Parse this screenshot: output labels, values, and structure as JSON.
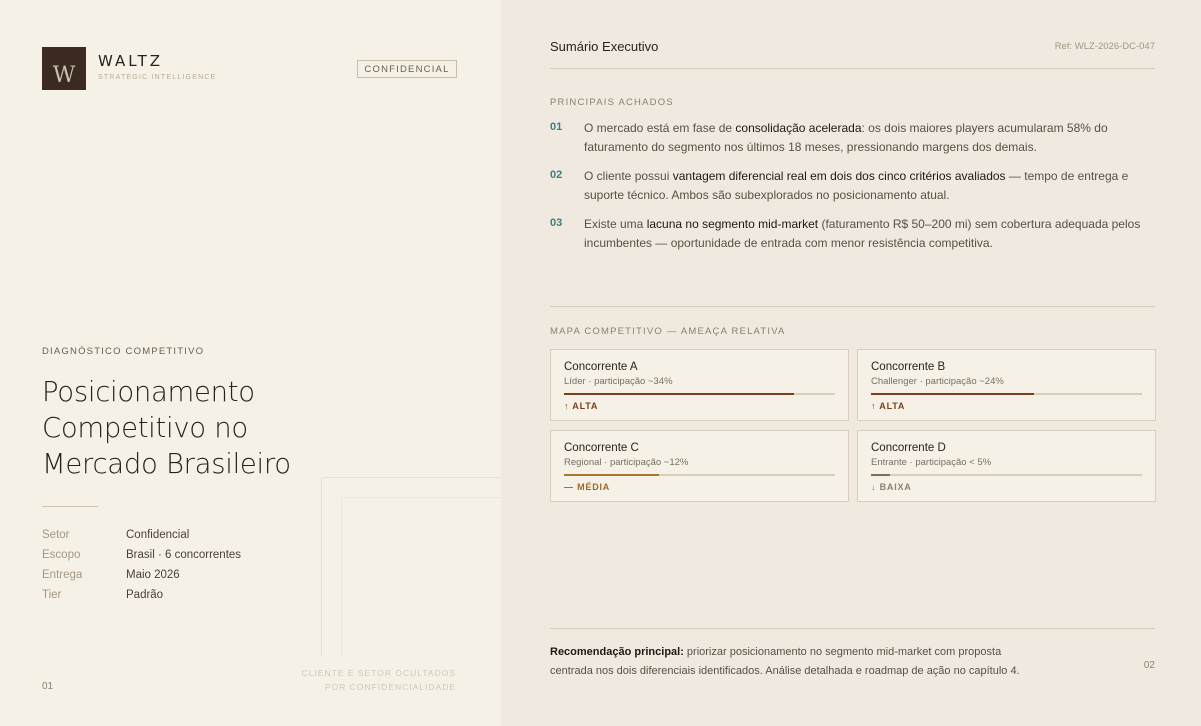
{
  "left": {
    "logo": {
      "name": "WALTZ",
      "tagline": "STRATEGIC INTELLIGENCE",
      "mark_letter": "W"
    },
    "badge": "CONFIDENCIAL",
    "kicker": "DIAGNÓSTICO COMPETITIVO",
    "title_lines": [
      "Posicionamento",
      "Competitivo no",
      "Mercado Brasileiro"
    ],
    "meta": [
      {
        "key": "Setor",
        "value": "Confidencial"
      },
      {
        "key": "Escopo",
        "value": "Brasil · 6 concorrentes"
      },
      {
        "key": "Entrega",
        "value": "Maio 2026"
      },
      {
        "key": "Tier",
        "value": "Padrão"
      }
    ],
    "page_number": "01",
    "hidden_note_lines": [
      "CLIENTE E SETOR OCULTADOS",
      "POR CONFIDENCIALIDADE"
    ]
  },
  "right": {
    "header_title": "Sumário Executivo",
    "ref": "Ref: WLZ-2026-DC-047",
    "findings_label": "PRINCIPAIS ACHADOS",
    "findings": [
      {
        "num": "01",
        "before": "O mercado está em fase de ",
        "bold": "consolidação acelerada",
        "after": ": os dois maiores players acumularam 58% do faturamento do segmento nos últimos 18 meses, pressionando margens dos demais."
      },
      {
        "num": "02",
        "before": "O cliente possui ",
        "bold": "vantagem diferencial real em dois dos cinco critérios avaliados",
        "after": " — tempo de entrega e suporte técnico. Ambos são subexplorados no posicionamento atual."
      },
      {
        "num": "03",
        "before": "Existe uma ",
        "bold": "lacuna no segmento mid-market",
        "after": " (faturamento R$ 50–200 mi) sem cobertura adequada pelos incumbentes — oportunidade de entrada com menor resistência competitiva."
      }
    ],
    "map_label": "MAPA COMPETITIVO — AMEAÇA RELATIVA",
    "competitors": [
      {
        "name": "Concorrente A",
        "sub": "Líder · participação ~34%",
        "level": "↑ ALTA",
        "threat": 0.85,
        "color": "#7a3e1e",
        "level_color": "#7a3e1e"
      },
      {
        "name": "Concorrente B",
        "sub": "Challenger · participação ~24%",
        "level": "↑ ALTA",
        "threat": 0.6,
        "color": "#7a3e1e",
        "level_color": "#7a3e1e"
      },
      {
        "name": "Concorrente C",
        "sub": "Regional · participação ~12%",
        "level": "— MÉDIA",
        "threat": 0.35,
        "color": "#a9772f",
        "level_color": "#9a6a2a"
      },
      {
        "name": "Concorrente D",
        "sub": "Entrante · participação < 5%",
        "level": "↓ BAIXA",
        "threat": 0.07,
        "color": "#7a6d60",
        "level_color": "#8c7f70"
      }
    ],
    "recommendation_lead": "Recomendação principal:",
    "recommendation_text": " priorizar posicionamento no segmento mid-market com proposta centrada nos dois diferenciais identificados. Análise detalhada e roadmap de ação no capítulo 4.",
    "page_number": "02"
  },
  "colors": {
    "accent_teal": "#3e7f7f",
    "brand_dark": "#3a2a22",
    "threat_high": "#7a3e1e"
  }
}
